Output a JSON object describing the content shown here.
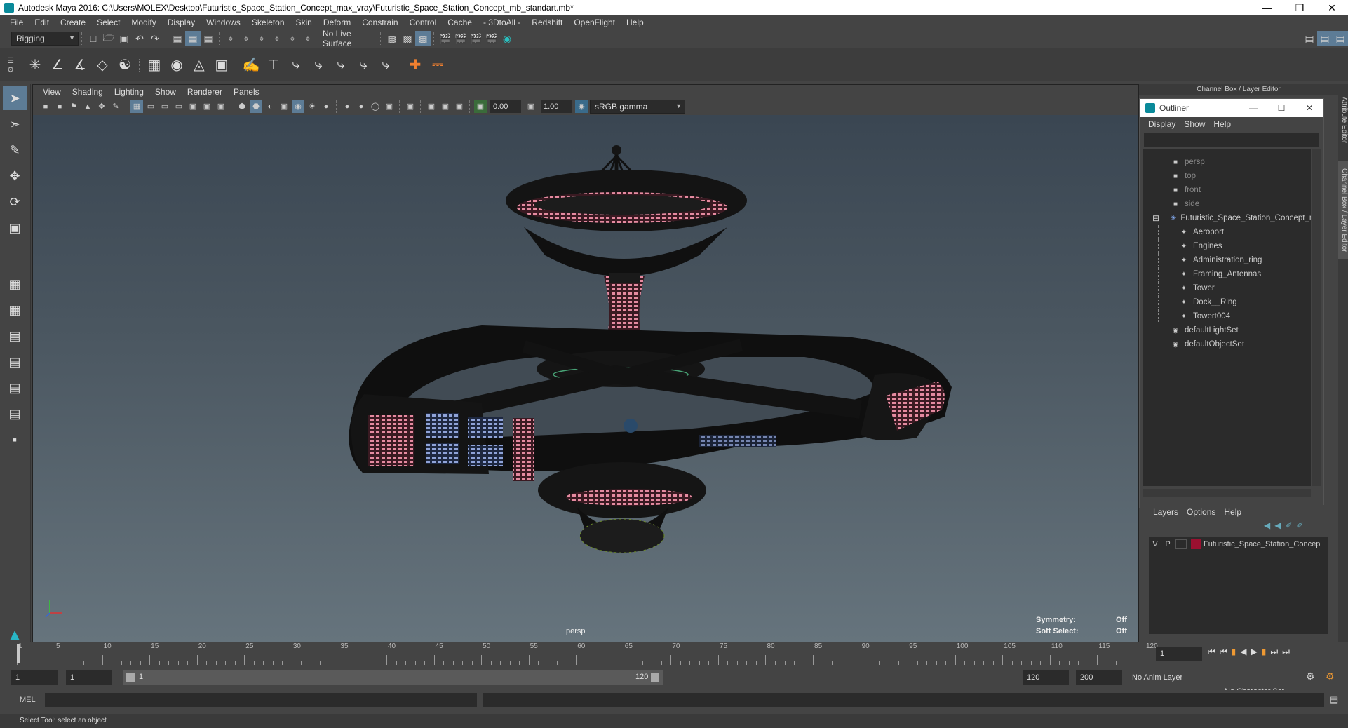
{
  "window": {
    "title": "Autodesk Maya 2016: C:\\Users\\MOLEX\\Desktop\\Futuristic_Space_Station_Concept_max_vray\\Futuristic_Space_Station_Concept_mb_standart.mb*"
  },
  "menubar": [
    "File",
    "Edit",
    "Create",
    "Select",
    "Modify",
    "Display",
    "Windows",
    "Skeleton",
    "Skin",
    "Deform",
    "Constrain",
    "Control",
    "Cache",
    "- 3DtoAll -",
    "Redshift",
    "OpenFlight",
    "Help"
  ],
  "statusline": {
    "menuset": "Rigging",
    "live_surface": "No Live Surface"
  },
  "viewport": {
    "menus": [
      "View",
      "Shading",
      "Lighting",
      "Show",
      "Renderer",
      "Panels"
    ],
    "exposure": "0.00",
    "gamma": "1.00",
    "colorspace": "sRGB gamma",
    "camera_label": "persp",
    "hud": {
      "symmetry_label": "Symmetry:",
      "symmetry_value": "Off",
      "softselect_label": "Soft Select:",
      "softselect_value": "Off"
    }
  },
  "channelbox": {
    "header": "Channel Box / Layer Editor"
  },
  "outliner": {
    "title": "Outliner",
    "menus": [
      "Display",
      "Show",
      "Help"
    ],
    "items": [
      {
        "label": "persp",
        "icon": "camera-icon",
        "dim": true,
        "indent": 0
      },
      {
        "label": "top",
        "icon": "camera-icon",
        "dim": true,
        "indent": 0
      },
      {
        "label": "front",
        "icon": "camera-icon",
        "dim": true,
        "indent": 0
      },
      {
        "label": "side",
        "icon": "camera-icon",
        "dim": true,
        "indent": 0
      },
      {
        "label": "Futuristic_Space_Station_Concept_r",
        "icon": "group-icon",
        "dim": false,
        "indent": 0
      },
      {
        "label": "Aeroport",
        "icon": "transform-icon",
        "dim": false,
        "indent": 1
      },
      {
        "label": "Engines",
        "icon": "transform-icon",
        "dim": false,
        "indent": 1
      },
      {
        "label": "Administration_ring",
        "icon": "transform-icon",
        "dim": false,
        "indent": 1
      },
      {
        "label": "Framing_Antennas",
        "icon": "transform-icon",
        "dim": false,
        "indent": 1
      },
      {
        "label": "Tower",
        "icon": "transform-icon",
        "dim": false,
        "indent": 1
      },
      {
        "label": "Dock__Ring",
        "icon": "transform-icon",
        "dim": false,
        "indent": 1
      },
      {
        "label": "Towert004",
        "icon": "transform-icon",
        "dim": false,
        "indent": 1
      },
      {
        "label": "defaultLightSet",
        "icon": "set-icon",
        "dim": false,
        "indent": 0
      },
      {
        "label": "defaultObjectSet",
        "icon": "set-icon",
        "dim": false,
        "indent": 0
      }
    ]
  },
  "layers": {
    "menus": [
      "Layers",
      "Options",
      "Help"
    ],
    "row": {
      "v": "V",
      "p": "P",
      "name": "Futuristic_Space_Station_Concep",
      "color": "#9b1030"
    }
  },
  "sidetabs": [
    "Attribute Editor",
    "Channel Box / Layer Editor"
  ],
  "timeslider": {
    "labels": [
      "1",
      "5",
      "10",
      "15",
      "20",
      "25",
      "30",
      "35",
      "40",
      "45",
      "50",
      "55",
      "60",
      "65",
      "70",
      "75",
      "80",
      "85",
      "90",
      "95",
      "100",
      "105",
      "110",
      "115",
      "120"
    ],
    "current_frame": "1"
  },
  "rangeslider": {
    "start": "1",
    "anim_start": "1",
    "range_start": "1",
    "range_end": "120",
    "anim_end_a": "120",
    "anim_end_b": "200",
    "anim_layer": "No Anim Layer",
    "char_set": "No Character Set"
  },
  "cmdline": {
    "lang": "MEL"
  },
  "helpline": {
    "text": "Select Tool: select an object"
  }
}
